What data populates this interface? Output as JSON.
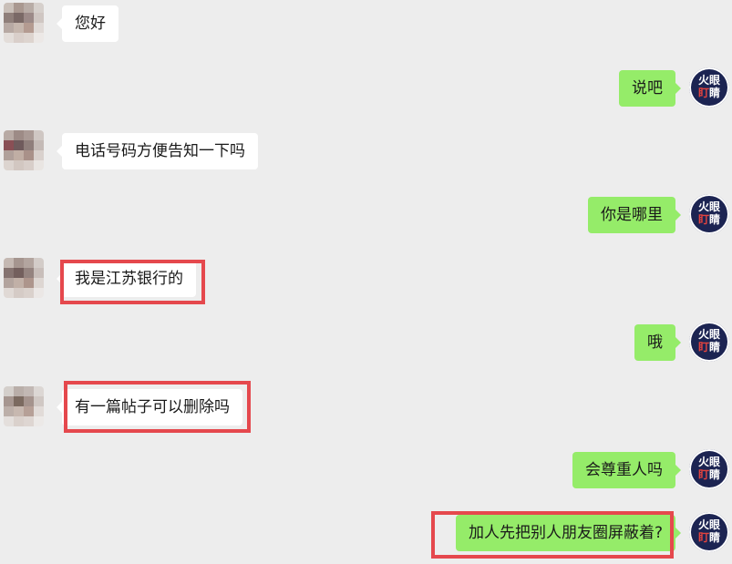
{
  "colors": {
    "background": "#ededed",
    "incoming_bubble": "#ffffff",
    "outgoing_bubble": "#95ec69",
    "highlight": "#e5484d",
    "brand_avatar": "#1c2452",
    "brand_accent": "#e2433f"
  },
  "brand_avatar": {
    "line1": "火眼",
    "line2_part1": "盯",
    "line2_part2": "睛"
  },
  "messages": [
    {
      "side": "incoming",
      "text": "您好",
      "highlighted": false
    },
    {
      "side": "outgoing",
      "text": "说吧",
      "highlighted": false
    },
    {
      "side": "incoming",
      "text": "电话号码方便告知一下吗",
      "highlighted": false
    },
    {
      "side": "outgoing",
      "text": "你是哪里",
      "highlighted": false
    },
    {
      "side": "incoming",
      "text": "我是江苏银行的",
      "highlighted": true
    },
    {
      "side": "outgoing",
      "text": "哦",
      "highlighted": false
    },
    {
      "side": "incoming",
      "text": "有一篇帖子可以删除吗",
      "highlighted": true
    },
    {
      "side": "outgoing",
      "text": "会尊重人吗",
      "highlighted": false
    },
    {
      "side": "outgoing",
      "text": "加人先把别人朋友圈屏蔽着?",
      "highlighted": true
    }
  ]
}
